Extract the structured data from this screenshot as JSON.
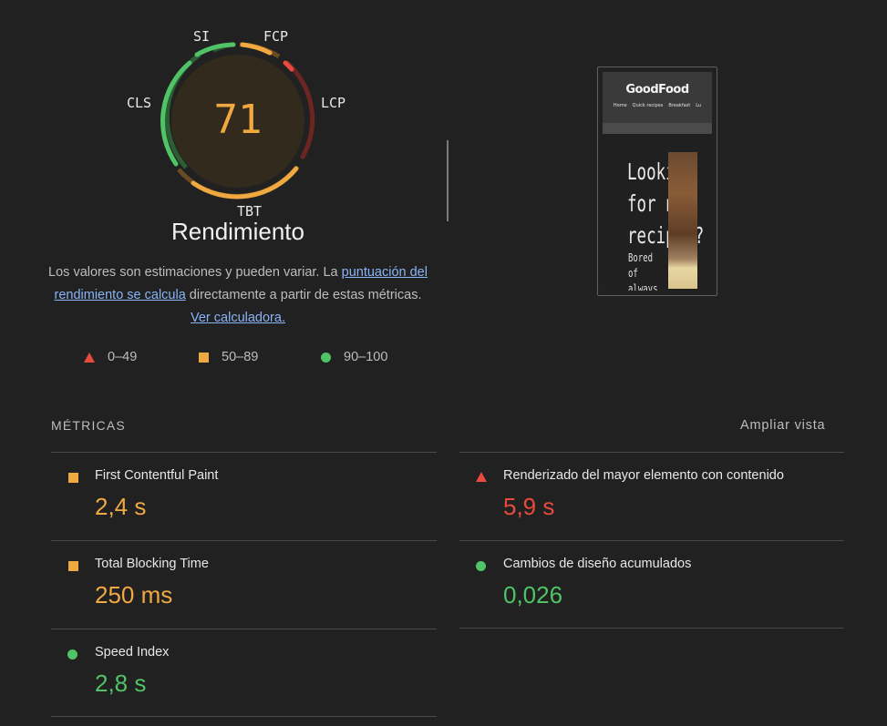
{
  "gauge": {
    "score": "71",
    "labels": {
      "si": "SI",
      "fcp": "FCP",
      "lcp": "LCP",
      "tbt": "TBT",
      "cls": "CLS"
    },
    "color": "#f0a940"
  },
  "title": "Rendimiento",
  "description": {
    "text1": "Los valores son estimaciones y pueden variar. La ",
    "link1": "puntuación del rendimiento se calcula",
    "text2": " directamente a partir de estas métricas. ",
    "link2": "Ver calculadora."
  },
  "legend": {
    "fail": "0–49",
    "average": "50–89",
    "pass": "90–100"
  },
  "screenshot": {
    "logo": "GoodFood",
    "nav": [
      "Home",
      "Quick recipes",
      "Breakfast",
      "Lu"
    ],
    "hero": "Looking\nfor new\nrecipes?",
    "sub": "Bored\nof\nalways"
  },
  "metrics": {
    "heading": "MÉTRICAS",
    "expand": "Ampliar vista",
    "items": [
      {
        "name": "First Contentful Paint",
        "value": "2,4 s",
        "rating": "average"
      },
      {
        "name": "Renderizado del mayor elemento con contenido",
        "value": "5,9 s",
        "rating": "fail"
      },
      {
        "name": "Total Blocking Time",
        "value": "250 ms",
        "rating": "average"
      },
      {
        "name": "Cambios de diseño acumulados",
        "value": "0,026",
        "rating": "pass"
      },
      {
        "name": "Speed Index",
        "value": "2,8 s",
        "rating": "pass"
      }
    ]
  },
  "colors": {
    "fail": "#e84a3c",
    "average": "#f0a940",
    "pass": "#4fc365",
    "background": "#212121"
  }
}
